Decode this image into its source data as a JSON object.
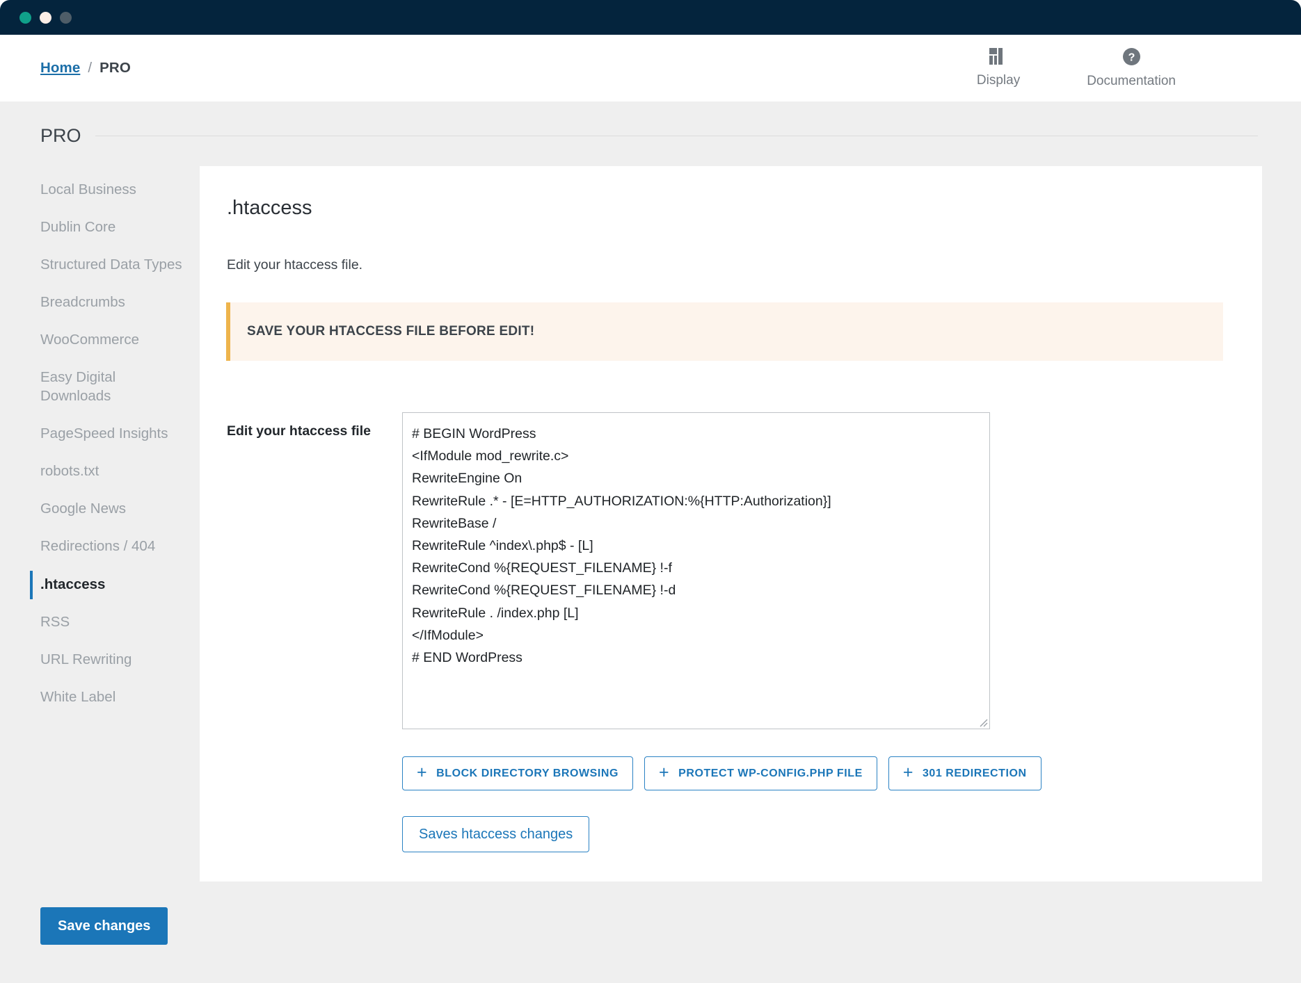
{
  "window": {
    "dots": [
      "green-dot",
      "cream-dot",
      "gray-dot"
    ]
  },
  "header": {
    "breadcrumb": {
      "home_label": "Home",
      "separator": "/",
      "current_label": "PRO"
    },
    "actions": [
      {
        "icon": "display-layout-icon",
        "label": "Display"
      },
      {
        "icon": "question-circle-icon",
        "label": "Documentation"
      }
    ]
  },
  "page": {
    "title": "PRO"
  },
  "sidebar": {
    "items": [
      {
        "label": "Local Business",
        "active": false
      },
      {
        "label": "Dublin Core",
        "active": false
      },
      {
        "label": "Structured Data Types",
        "active": false
      },
      {
        "label": "Breadcrumbs",
        "active": false
      },
      {
        "label": "WooCommerce",
        "active": false
      },
      {
        "label": "Easy Digital Downloads",
        "active": false
      },
      {
        "label": "PageSpeed Insights",
        "active": false
      },
      {
        "label": "robots.txt",
        "active": false
      },
      {
        "label": "Google News",
        "active": false
      },
      {
        "label": "Redirections / 404",
        "active": false
      },
      {
        "label": ".htaccess",
        "active": true
      },
      {
        "label": "RSS",
        "active": false
      },
      {
        "label": "URL Rewriting",
        "active": false
      },
      {
        "label": "White Label",
        "active": false
      }
    ]
  },
  "card": {
    "title": ".htaccess",
    "subtitle": "Edit your htaccess file.",
    "notice": "SAVE YOUR HTACCESS FILE BEFORE EDIT!",
    "field_label": "Edit your htaccess file",
    "htaccess_value": "# BEGIN WordPress\n<IfModule mod_rewrite.c>\nRewriteEngine On\nRewriteRule .* - [E=HTTP_AUTHORIZATION:%{HTTP:Authorization}]\nRewriteBase /\nRewriteRule ^index\\.php$ - [L]\nRewriteCond %{REQUEST_FILENAME} !-f\nRewriteCond %{REQUEST_FILENAME} !-d\nRewriteRule . /index.php [L]\n</IfModule>\n# END WordPress",
    "snippet_buttons": [
      {
        "icon": "plus-icon",
        "label": "BLOCK DIRECTORY BROWSING"
      },
      {
        "icon": "plus-icon",
        "label": "PROTECT WP-CONFIG.PHP FILE"
      },
      {
        "icon": "plus-icon",
        "label": "301 REDIRECTION"
      }
    ],
    "save_htaccess_label": "Saves htaccess changes"
  },
  "footer": {
    "save_changes_label": "Save changes"
  },
  "colors": {
    "titlebar": "#04243d",
    "accent_blue": "#1b76b8",
    "notice_border": "#eeb44c",
    "notice_bg": "#fdf4ec",
    "page_bg": "#efefef",
    "dot_green": "#10a08a",
    "dot_cream": "#fbeee7",
    "dot_gray": "#4e5d68"
  }
}
